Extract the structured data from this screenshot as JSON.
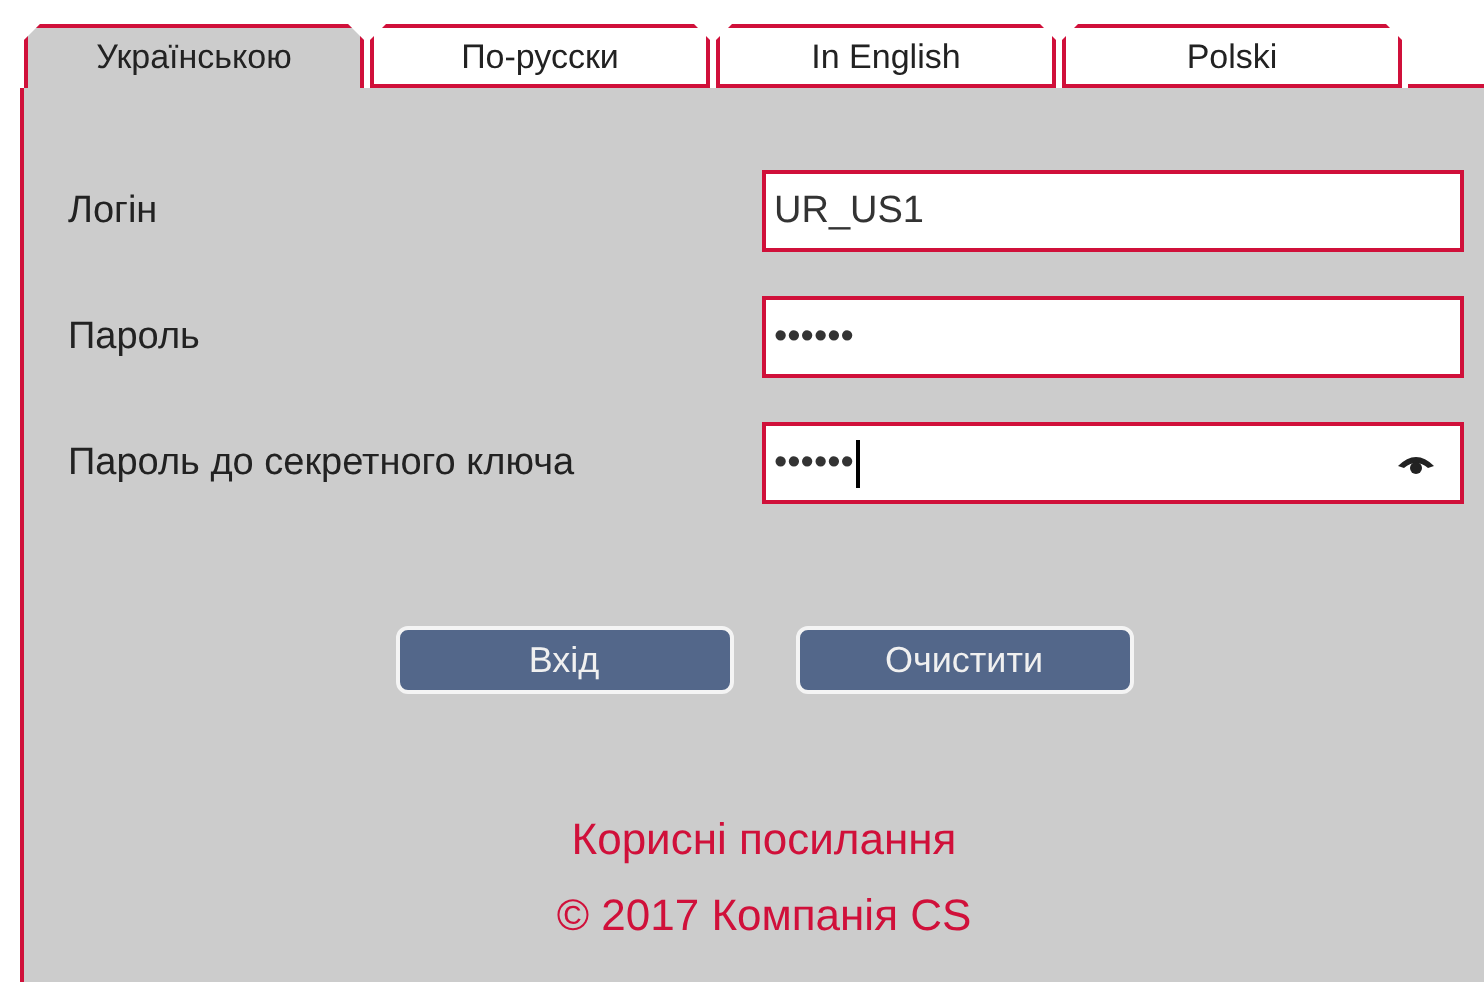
{
  "tabs": [
    {
      "label": "Українською",
      "selected": true
    },
    {
      "label": "По-русски",
      "selected": false
    },
    {
      "label": "In English",
      "selected": false
    },
    {
      "label": "Polski",
      "selected": false
    }
  ],
  "fields": [
    {
      "label": "Логін",
      "value": "UR_US1",
      "focused": false,
      "reveal_toggle": false
    },
    {
      "label": "Пароль",
      "value": "••••••",
      "focused": false,
      "reveal_toggle": false
    },
    {
      "label": "Пароль до секретного ключа",
      "value": "••••••",
      "focused": true,
      "reveal_toggle": true
    }
  ],
  "buttons": [
    "Вхід",
    "Очистити"
  ],
  "footer": {
    "link": "Корисні посилання",
    "copyright": "© 2017 Компанія CS"
  }
}
